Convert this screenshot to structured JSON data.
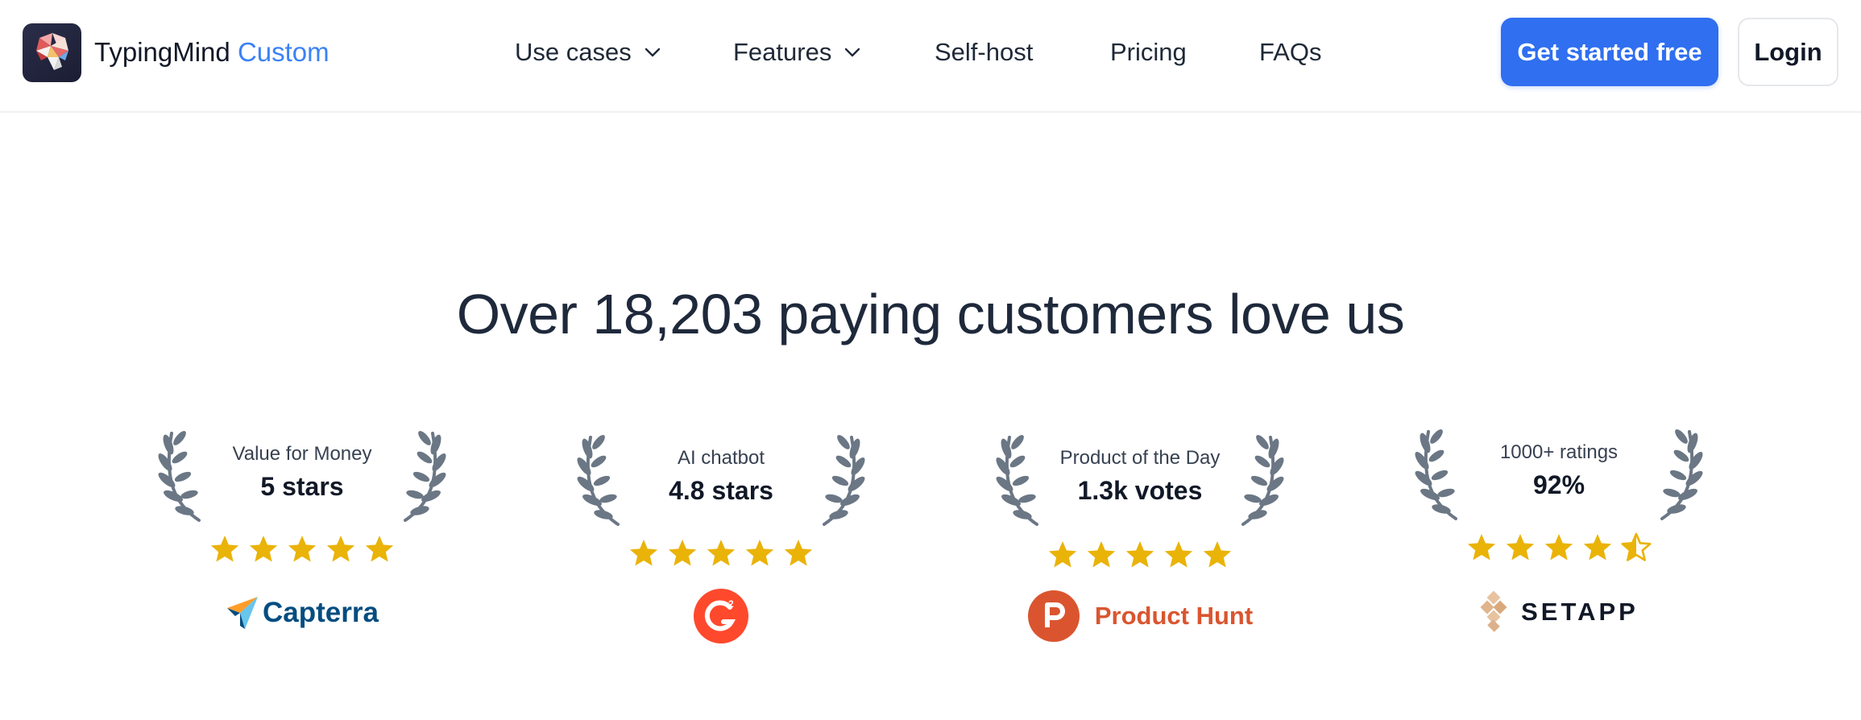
{
  "brand": {
    "name": "TypingMind",
    "accent": "Custom",
    "logo_icon": "brain-logo-icon"
  },
  "nav": {
    "items": [
      {
        "label": "Use cases",
        "has_dropdown": true
      },
      {
        "label": "Features",
        "has_dropdown": true
      },
      {
        "label": "Self-host",
        "has_dropdown": false
      },
      {
        "label": "Pricing",
        "has_dropdown": false
      },
      {
        "label": "FAQs",
        "has_dropdown": false
      }
    ]
  },
  "actions": {
    "primary_label": "Get started free",
    "secondary_label": "Login"
  },
  "hero": {
    "headline": "Over 18,203 paying customers love us"
  },
  "awards": [
    {
      "caption": "Value for Money",
      "value": "5 stars",
      "rating": 5,
      "brand": "Capterra",
      "brand_icon": "capterra-logo-icon"
    },
    {
      "caption": "AI chatbot",
      "value": "4.8 stars",
      "rating": 5,
      "brand": "G2",
      "brand_icon": "g2-logo-icon"
    },
    {
      "caption": "Product of the Day",
      "value": "1.3k votes",
      "rating": 5,
      "brand": "Product Hunt",
      "brand_icon": "product-hunt-logo-icon"
    },
    {
      "caption": "1000+ ratings",
      "value": "92%",
      "rating": 4.5,
      "brand": "SETAPP",
      "brand_icon": "setapp-logo-icon"
    }
  ],
  "colors": {
    "primary": "#2f6ff0",
    "accent_text": "#3b82f6",
    "star": "#eab308",
    "laurel": "#6b7785",
    "capterra_blue": "#044d80",
    "g2_red": "#ff492c",
    "product_hunt": "#da552f"
  }
}
